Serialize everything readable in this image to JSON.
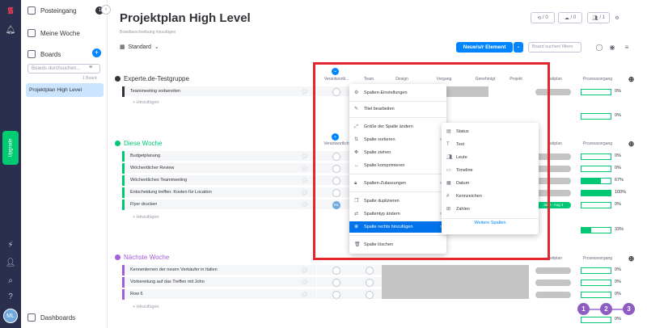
{
  "sidebar": {
    "inbox_label": "Posteingang",
    "inbox_count": "1",
    "my_week_label": "Meine Woche",
    "boards_label": "Boards",
    "board_search_placeholder": "Boards durchsuchen...",
    "boards_count": "1 Board",
    "active_board": "Projektplan High Level",
    "dashboards_label": "Dashboards"
  },
  "rail": {
    "upgrade_label": "Upgrade",
    "avatar_initials": "ML"
  },
  "header": {
    "title": "Projektplan High Level",
    "description": "Boardbeschreibung hinzufügen",
    "activity_count_1": "/ 0",
    "activity_count_2": "/ 0",
    "members_count": "/ 1"
  },
  "toolbar": {
    "view_label": "Standard",
    "new_item_label": "Neue/s/r Element",
    "search_placeholder": "Board suchen/ filtern"
  },
  "columns": {
    "owner": "Verantwortli...",
    "owner_short": "Verantwortlich",
    "team": "Team",
    "design": "Design",
    "process": "Vorgang",
    "approved": "Genehmigt",
    "project": "Projekt",
    "timeline": "Zeitplan",
    "progress": "Prozessvorgang"
  },
  "groups": [
    {
      "name": "Experte.de-Testgruppe",
      "color": "#323338",
      "items": [
        {
          "name": "Teammeeting vorbereiten",
          "pct": "0%",
          "fill": 0
        }
      ],
      "add_label": "+ Hinzufügen",
      "summary_pct": "0%"
    },
    {
      "name": "Diese Woche",
      "color": "#00c875",
      "items": [
        {
          "name": "Budgetplanung",
          "pct": "0%",
          "fill": 0
        },
        {
          "name": "Wöchentlicher Review",
          "pct": "0%",
          "fill": 0
        },
        {
          "name": "Wöchentliches Teammeeting",
          "pct": "67%",
          "fill": 0.67
        },
        {
          "name": "Entscheidung treffen: Kosten für Location",
          "pct": "100%",
          "fill": 1
        },
        {
          "name": "Flyer drucken",
          "pct": "0%",
          "fill": 0
        }
      ],
      "add_label": "+ Hinzufügen",
      "summary_pct": "33%",
      "flyer_owner": "ML",
      "flyer_timeline": "Jul 3 - Aug 4"
    },
    {
      "name": "Nächste Woche",
      "color": "#a25ddc",
      "items": [
        {
          "name": "Kennenlernen der neuen Verkäufer in Italien",
          "pct": "0%",
          "fill": 0
        },
        {
          "name": "Vorbereitung auf das Treffen mit John",
          "pct": "0%",
          "fill": 0
        },
        {
          "name": "Row 6",
          "pct": "0%",
          "fill": 0
        }
      ],
      "add_label": "+ Hinzufügen",
      "summary_pct": "0%"
    }
  ],
  "context_menu": {
    "items": [
      "Spalten-Einstellungen",
      "Titel bearbeiten",
      "Größe der Spalte ändern",
      "Spalte sortieren",
      "Spalte ziehen",
      "Spalte komprimieren",
      "Spalten-Zulassungen",
      "Spalte duplizieren",
      "Spaltentyp ändern",
      "Spalte rechts hinzufügen",
      "Spalte löschen"
    ]
  },
  "submenu": {
    "items": [
      "Status",
      "Text",
      "Leute",
      "Timeline",
      "Datum",
      "Kennzeichen",
      "Zahlen"
    ],
    "more_label": "Weitere Spalten"
  },
  "callouts": [
    "1",
    "2",
    "3"
  ],
  "colors": {
    "accent": "#0085ff",
    "rail": "#292f4c",
    "highlight_box": "#e2272f",
    "green": "#00c875",
    "purple": "#a25ddc",
    "callout": "#8e5cc3"
  }
}
